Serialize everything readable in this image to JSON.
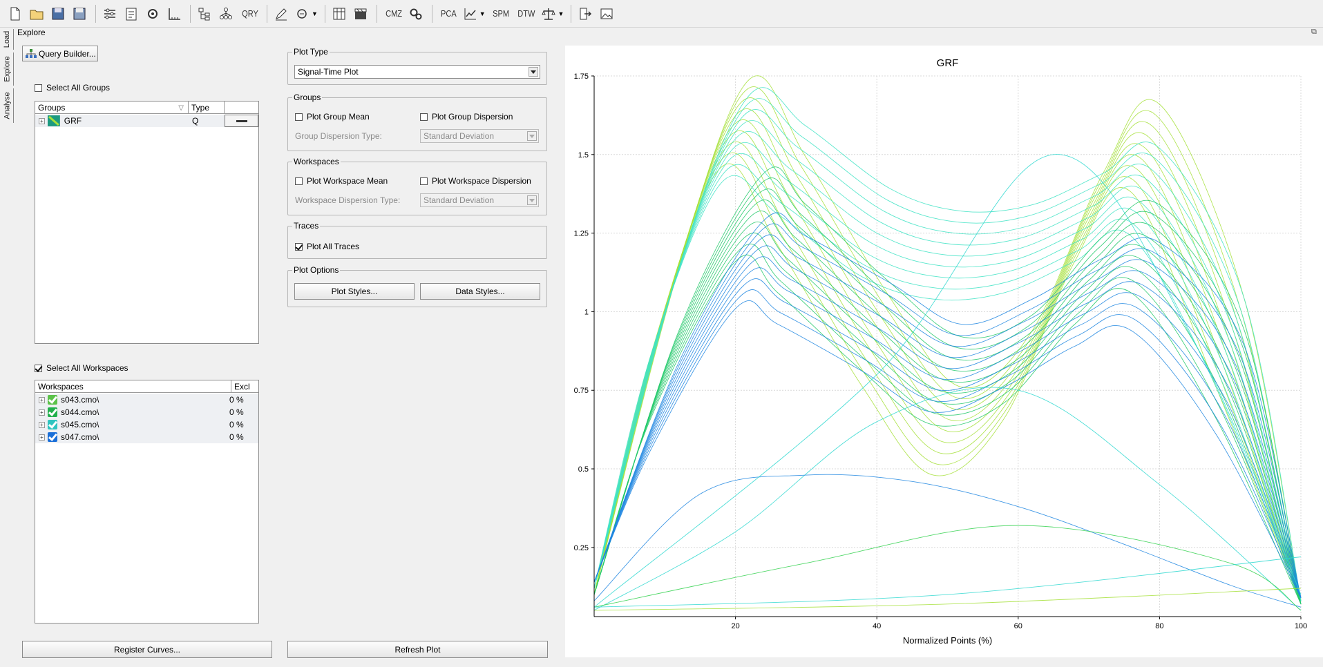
{
  "toolbar": {
    "icons": [
      "new-file-icon",
      "open-folder-icon",
      "save-icon",
      "save-as-icon",
      "settings-sliders-icon",
      "properties-icon",
      "config-gear-icon",
      "measure-icon",
      "tree-hierarchy-icon",
      "network-icon",
      "query-icon",
      "edit-pen-icon",
      "link-icon",
      "calculator-icon",
      "clapper-icon",
      "cmz-icon",
      "gears-icon",
      "line-chart-icon",
      "balance-icon",
      "export-icon",
      "image-icon"
    ],
    "qry_label": "QRY",
    "cmz_label": "CMZ",
    "pca_label": "PCA",
    "spm_label": "SPM",
    "dtw_label": "DTW"
  },
  "side_tabs": [
    "Load",
    "Explore",
    "Analyse"
  ],
  "explore": {
    "title": "Explore",
    "query_builder_label": "Query Builder...",
    "select_all_groups_label": "Select All Groups",
    "select_all_groups_checked": false,
    "groups_table": {
      "headers": [
        "Groups",
        "Type",
        ""
      ],
      "rows": [
        {
          "name": "GRF",
          "type": "Q",
          "color": "#1c9a80"
        }
      ]
    },
    "select_all_workspaces_label": "Select All Workspaces",
    "select_all_workspaces_checked": true,
    "workspaces_table": {
      "headers": [
        "Workspaces",
        "Excl"
      ],
      "rows": [
        {
          "name": "s043.cmo\\",
          "excl": "0 %",
          "color": "#5cc24a"
        },
        {
          "name": "s044.cmo\\",
          "excl": "0 %",
          "color": "#22b04c"
        },
        {
          "name": "s045.cmo\\",
          "excl": "0 %",
          "color": "#2fc4c0"
        },
        {
          "name": "s047.cmo\\",
          "excl": "0 %",
          "color": "#1a6fd8"
        }
      ]
    },
    "register_curves_label": "Register Curves..."
  },
  "plot_type": {
    "title": "Plot Type",
    "selected": "Signal-Time Plot"
  },
  "groups_panel": {
    "title": "Groups",
    "mean_label": "Plot Group Mean",
    "mean_checked": false,
    "dispersion_label": "Plot Group Dispersion",
    "dispersion_checked": false,
    "dispersion_type_label": "Group Dispersion Type:",
    "dispersion_type_value": "Standard Deviation"
  },
  "workspaces_panel": {
    "title": "Workspaces",
    "mean_label": "Plot Workspace Mean",
    "mean_checked": false,
    "dispersion_label": "Plot Workspace Dispersion",
    "dispersion_checked": false,
    "dispersion_type_label": "Workspace Dispersion Type:",
    "dispersion_type_value": "Standard Deviation"
  },
  "traces_panel": {
    "title": "Traces",
    "plot_all_label": "Plot All Traces",
    "plot_all_checked": true
  },
  "plot_options": {
    "title": "Plot Options",
    "plot_styles_label": "Plot Styles...",
    "data_styles_label": "Data Styles..."
  },
  "refresh_plot_label": "Refresh Plot",
  "chart_data": {
    "type": "line",
    "title": "GRF",
    "xlabel": "Normalized Points (%)",
    "ylabel": "",
    "xlim": [
      0,
      100
    ],
    "ylim": [
      0.03,
      1.75
    ],
    "xticks": [
      20,
      40,
      60,
      80,
      100
    ],
    "yticks": [
      0.25,
      0.5,
      0.75,
      1,
      1.25,
      1.5,
      1.75
    ],
    "ytick_labels": [
      "0.25",
      "0.5",
      "0.75",
      "1",
      "1.25",
      "1.5",
      "1.75"
    ],
    "grid": true,
    "series": [
      {
        "color": "#a6e03a",
        "x": [
          0,
          10,
          20,
          28,
          40,
          50,
          60,
          70,
          78,
          90,
          100
        ],
        "y": [
          0.1,
          1.0,
          1.6,
          1.35,
          0.9,
          0.62,
          0.8,
          1.3,
          1.52,
          0.9,
          0.08
        ]
      },
      {
        "color": "#3ee3c4",
        "x": [
          0,
          10,
          20,
          28,
          40,
          50,
          60,
          70,
          78,
          90,
          100
        ],
        "y": [
          0.12,
          1.0,
          1.55,
          1.45,
          1.25,
          1.18,
          1.2,
          1.3,
          1.38,
          0.9,
          0.08
        ]
      },
      {
        "color": "#22c96a",
        "x": [
          0,
          10,
          22,
          28,
          40,
          50,
          60,
          70,
          78,
          90,
          100
        ],
        "y": [
          0.1,
          0.8,
          1.3,
          1.2,
          0.95,
          0.78,
          0.85,
          1.1,
          1.2,
          0.8,
          0.07
        ]
      },
      {
        "color": "#1f86e0",
        "x": [
          0,
          10,
          22,
          28,
          40,
          50,
          60,
          70,
          78,
          90,
          100
        ],
        "y": [
          0.14,
          0.7,
          1.15,
          1.1,
          0.95,
          0.82,
          0.9,
          1.03,
          1.08,
          0.75,
          0.09
        ]
      },
      {
        "color": "#2fd8d0",
        "x": [
          0,
          20,
          40,
          60,
          80,
          100
        ],
        "y": [
          0.05,
          0.3,
          0.65,
          0.75,
          0.45,
          0.05
        ]
      },
      {
        "color": "#1f86e0",
        "x": [
          0,
          15,
          30,
          45,
          60,
          75,
          90,
          100
        ],
        "y": [
          0.08,
          0.42,
          0.48,
          0.46,
          0.38,
          0.26,
          0.13,
          0.06
        ]
      },
      {
        "color": "#33d14e",
        "x": [
          0,
          30,
          60,
          90,
          100
        ],
        "y": [
          0.06,
          0.2,
          0.32,
          0.2,
          0.05
        ]
      },
      {
        "color": "#2fd8d0",
        "x": [
          0,
          40,
          65,
          85,
          100
        ],
        "y": [
          0.06,
          0.8,
          1.5,
          0.9,
          0.1
        ]
      },
      {
        "color": "#a6e03a",
        "x": [
          0,
          50,
          100
        ],
        "y": [
          0.05,
          0.07,
          0.12
        ]
      },
      {
        "color": "#2fd8d0",
        "x": [
          0,
          50,
          100
        ],
        "y": [
          0.06,
          0.1,
          0.22
        ]
      }
    ]
  }
}
